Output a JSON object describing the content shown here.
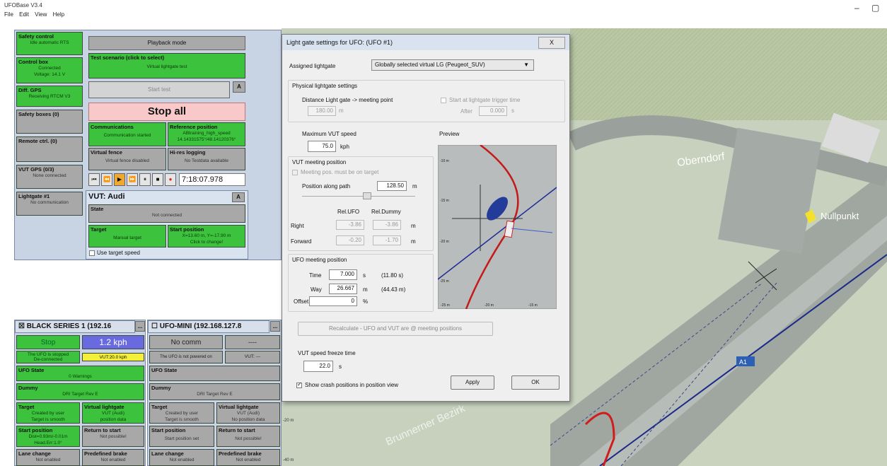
{
  "app": {
    "title": "UFOBase V3.4",
    "menu": [
      "File",
      "Edit",
      "View",
      "Help"
    ],
    "minimize": "–",
    "maximize": "▢"
  },
  "left": {
    "safety_control": {
      "title": "Safety control",
      "value": "Idle automatic RTS"
    },
    "control_box": {
      "title": "Control box",
      "value1": "Connected",
      "value2": "Voltage: 14.1 V"
    },
    "diff_gps": {
      "title": "Diff. GPS",
      "value": "Receiving RTCM V3"
    },
    "safety_boxes": {
      "title": "Safety boxes (0)"
    },
    "remote_ctrl": {
      "title": "Remote ctrl. (0)"
    },
    "vut_gps": {
      "title": "VUT GPS (0/3)",
      "value": "None connected"
    },
    "lightgate": {
      "title": "Lightgate #1",
      "value": "No communication"
    },
    "playback": "Playback mode",
    "test_scenario": {
      "title": "Test scenario (click to select)",
      "value": "Virtual lightgate test"
    },
    "start_test": "Start test",
    "a_label": "A",
    "stop_all": "Stop all",
    "communications": {
      "title": "Communications",
      "value": "Communication started"
    },
    "reference_position": {
      "title": "Reference position",
      "value1": "ABtraining_high_speed",
      "value2": "14.14331575°/48.14120376°"
    },
    "virtual_fence": {
      "title": "Virtual fence",
      "value": "Virtual fence disabled"
    },
    "hires_logging": {
      "title": "Hi-res logging",
      "value": "No Testdata available"
    },
    "time": "7:18:07.978",
    "vut": {
      "title": "VUT: Audi",
      "a": "A",
      "state_title": "State",
      "state_value": "Not connected",
      "target_title": "Target",
      "target_value": "Manual target",
      "start_title": "Start position",
      "start_value1": "X=13.60 m, Y=-17.90 m",
      "start_value2": "Click to change!",
      "use_target_speed": "Use target speed"
    }
  },
  "bottom": {
    "black": {
      "header": "BLACK SERIES 1 (192.16",
      "more": "...",
      "stop": "Stop",
      "speed": "1.2 kph",
      "info1": "The UFO is stopped",
      "info2": "De-connected",
      "vut_speed": "VUT:20.0 kph",
      "ufo_state_title": "UFO State",
      "ufo_state_value": "0 Warnings",
      "dummy_title": "Dummy",
      "dummy_value": "DRI Target Rev E",
      "target_title": "Target",
      "target_v1": "Created by user",
      "target_v2": "Target is smooth",
      "vlg_title": "Virtual lightgate",
      "vlg_v1": "VUT (Audi)",
      "vlg_v2": "position data",
      "startpos_title": "Start position",
      "startpos_v1": "Dist=0.93m/-0.01m",
      "startpos_v2": "Head.Err:1.0°",
      "return_title": "Return to start",
      "return_value": "Not possible!",
      "lane_title": "Lane change",
      "lane_value": "Not enabled",
      "brake_title": "Predefined brake",
      "brake_value": "Not enabled"
    },
    "mini": {
      "header": "UFO-MINI (192.168.127.8",
      "more": "...",
      "nocomm": "No comm",
      "dash": "----",
      "info": "The UFO is not powered on",
      "vut": "VUT: ---",
      "ufo_state_title": "UFO State",
      "dummy_title": "Dummy",
      "dummy_value": "DRI Target Rev E",
      "target_title": "Target",
      "target_v1": "Created by user",
      "target_v2": "Target is smooth",
      "vlg_title": "Virtual lightgate",
      "vlg_v1": "VUT (Audi)",
      "vlg_v2": "No position data",
      "startpos_title": "Start position",
      "startpos_value": "Start position set",
      "return_title": "Return to start",
      "return_value": "Not possible!",
      "lane_title": "Lane change",
      "lane_value": "Not enabled",
      "brake_title": "Predefined brake",
      "brake_value": "Not enabled"
    }
  },
  "dialog": {
    "title": "Light gate settings for UFO: (UFO #1)",
    "close": "X",
    "assigned_label": "Assigned lightgate",
    "assigned_value": "Globally selected virtual LG (Peugeot_SUV)",
    "physical_group": "Physical lightgate settings",
    "distance_label": "Distance Light gate -> meeting point",
    "distance_value": "180.00",
    "distance_unit": "m",
    "start_trigger_label": "Start at lightgate trigger time",
    "after_label": "After",
    "after_value": "0.000",
    "after_unit": "s",
    "max_speed_label": "Maximum VUT speed",
    "max_speed_value": "75.0",
    "max_speed_unit": "kph",
    "preview_label": "Preview",
    "vut_meeting_group": "VUT meeting position",
    "meeting_target_label": "Meeting pos. must be on target",
    "position_path_label": "Position along path",
    "position_path_value": "128.50",
    "position_path_unit": "m",
    "rel_ufo": "Rel.UFO",
    "rel_dummy": "Rel.Dummy",
    "right_label": "Right",
    "right_ufo": "-3.86",
    "right_dummy": "-3.86",
    "right_unit": "m",
    "forward_label": "Forward",
    "forward_ufo": "-0.20",
    "forward_dummy": "-1.70",
    "forward_unit": "m",
    "ufo_meeting_group": "UFO meeting position",
    "time_label": "Time",
    "time_value": "7.000",
    "time_unit": "s",
    "time_extra": "(11.80 s)",
    "way_label": "Way",
    "way_value": "26.667",
    "way_unit": "m",
    "way_extra": "(44.43 m)",
    "offset_label": "Offset:",
    "offset_value": "0",
    "offset_unit": "%",
    "recalc": "Recalculate - UFO and VUT are @ meeting positions",
    "freeze_label": "VUT speed freeze time",
    "freeze_value": "22.0",
    "freeze_unit": "s",
    "show_crash_label": "Show crash positions in position view",
    "apply": "Apply",
    "ok": "OK",
    "preview_ticks_y": [
      "-10 m",
      "-15 m",
      "-20 m",
      "-25 m"
    ],
    "preview_ticks_x": [
      "-25 m",
      "-20 m",
      "-15 m"
    ]
  },
  "map": {
    "labels": {
      "obern": "Oberndorf",
      "nullpunkt": "Nullpunkt",
      "a1": "A1",
      "bezirk": "Brunnerner Bezirk"
    },
    "ticks_y": [
      "-20 m",
      "-40 m"
    ]
  }
}
